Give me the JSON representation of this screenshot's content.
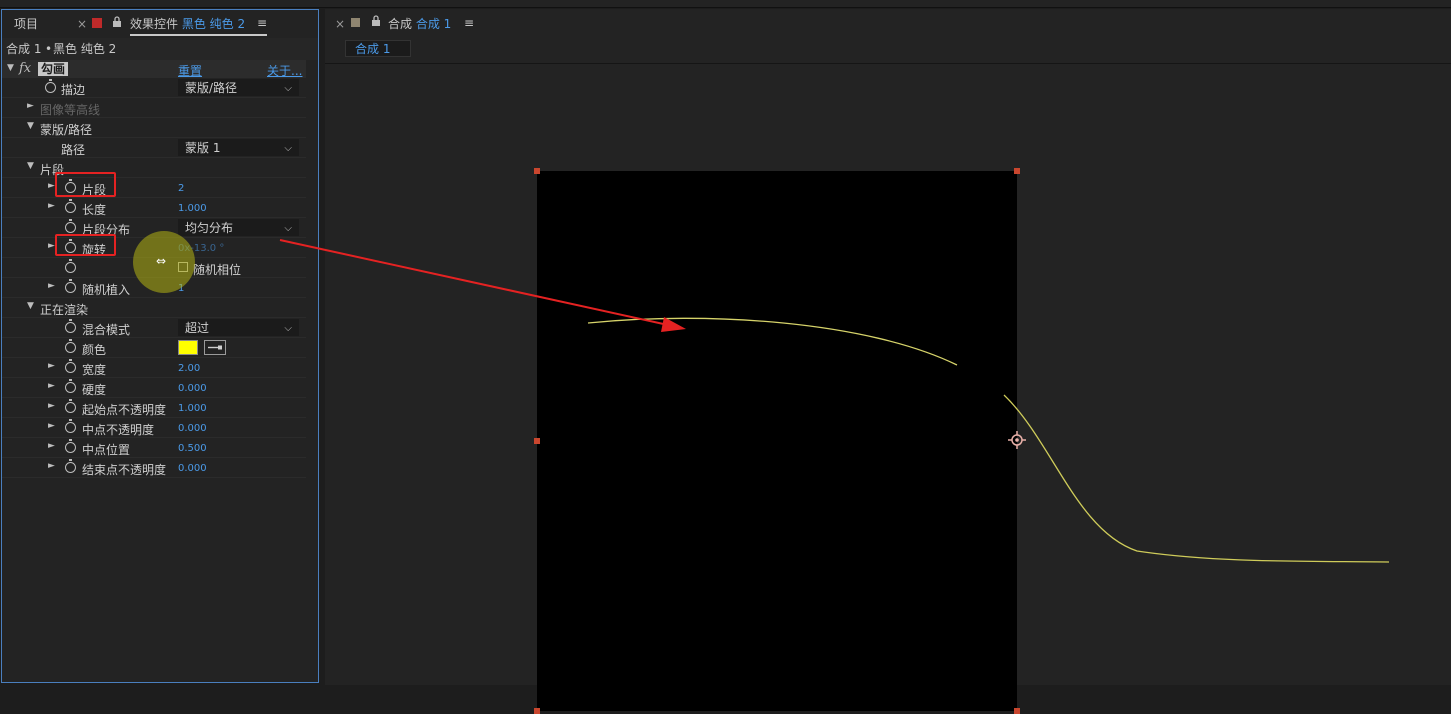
{
  "effect_panel": {
    "close": "×",
    "tab_project": "项目",
    "tab_effects_prefix": "效果控件",
    "tab_effects_layer": "黑色 纯色 2",
    "menu": "≡",
    "breadcrumb_comp": "合成 1",
    "breadcrumb_sep": "•",
    "breadcrumb_layer": "黑色 纯色 2",
    "fx_label": "fx",
    "effect_name": "勾画",
    "reset": "重置",
    "about": "关于...",
    "properties": [
      {
        "name": "描边",
        "value": "蒙版/路径"
      },
      {
        "name": "图像等高线",
        "value": ""
      },
      {
        "name": "蒙版/路径",
        "value": ""
      },
      {
        "name": "路径",
        "value": "蒙版 1"
      },
      {
        "name": "片段",
        "value": ""
      },
      {
        "name": "片段",
        "value": "2"
      },
      {
        "name": "长度",
        "value": "1.000"
      },
      {
        "name": "片段分布",
        "value": "均匀分布"
      },
      {
        "name": "旋转",
        "value": "0x-13.0 °"
      },
      {
        "name": "",
        "value": "随机相位"
      },
      {
        "name": "随机植入",
        "value": "1"
      },
      {
        "name": "正在渲染",
        "value": ""
      },
      {
        "name": "混合模式",
        "value": "超过"
      },
      {
        "name": "颜色",
        "value": ""
      },
      {
        "name": "宽度",
        "value": "2.00"
      },
      {
        "name": "硬度",
        "value": "0.000"
      },
      {
        "name": "起始点不透明度",
        "value": "1.000"
      },
      {
        "name": "中点不透明度",
        "value": "0.000"
      },
      {
        "name": "中点位置",
        "value": "0.500"
      },
      {
        "name": "结束点不透明度",
        "value": "0.000"
      }
    ]
  },
  "comp_panel": {
    "close": "×",
    "title_prefix": "合成",
    "title_comp": "合成 1",
    "menu": "≡",
    "sub_tab": "合成 1"
  },
  "colors": {
    "stroke_color": "#ffff00",
    "accent": "#4b9ae8",
    "highlight": "#e52222",
    "handle": "#c9462e"
  },
  "icons": [
    "close-icon",
    "lock-icon",
    "menu-icon",
    "stopwatch-icon",
    "twirl-triangle-icon",
    "chevron-down-icon",
    "eyedropper-icon",
    "anchor-point-icon",
    "resize-cursor-icon"
  ]
}
